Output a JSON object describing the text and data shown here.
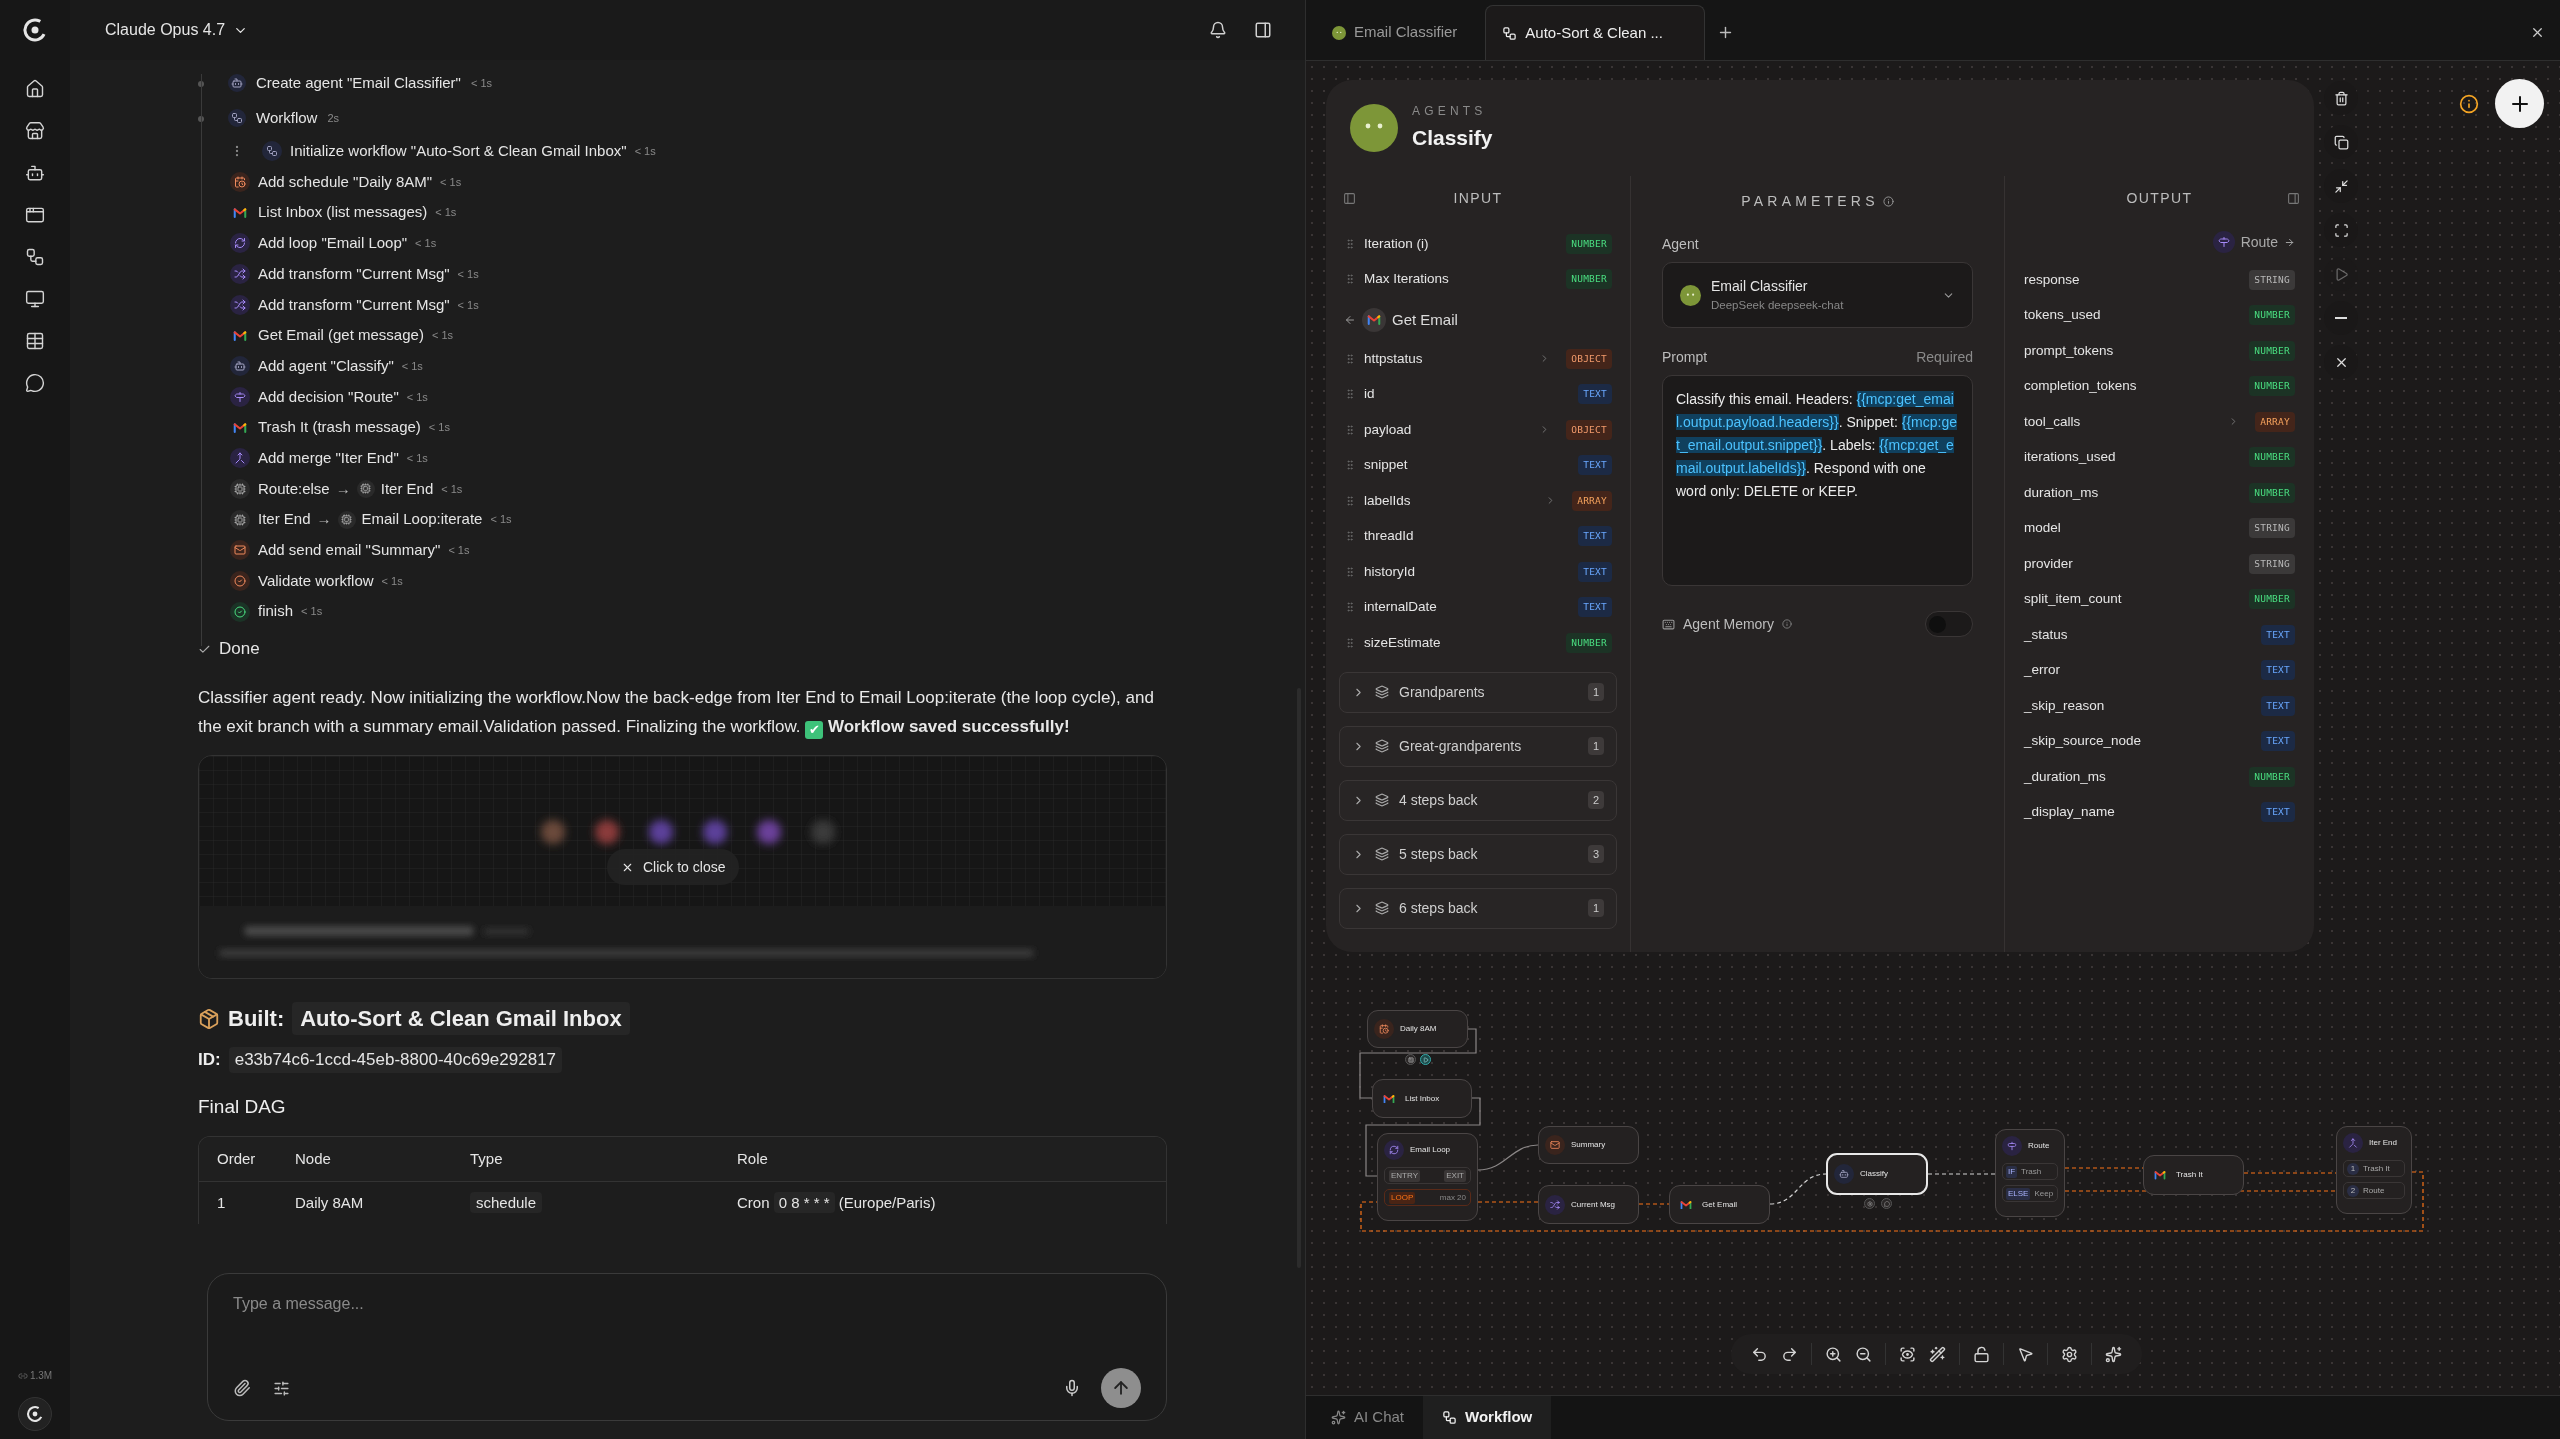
{
  "header": {
    "model": "Claude Opus 4.7"
  },
  "sidebar": {
    "usage": "1.3M"
  },
  "activity": {
    "items": [
      {
        "kind": "agent",
        "text": "Create agent \"Email Classifier\"",
        "time": "< 1s"
      },
      {
        "kind": "workflow",
        "text": "Workflow",
        "time": "2s",
        "children": [
          {
            "kind": "workflow",
            "text": "Initialize workflow \"Auto-Sort & Clean Gmail Inbox\"",
            "time": "< 1s"
          },
          {
            "kind": "schedule",
            "text": "Add schedule \"Daily 8AM\"",
            "time": "< 1s"
          },
          {
            "kind": "gmail",
            "text": "List Inbox (list messages)",
            "time": "< 1s"
          },
          {
            "kind": "loop",
            "text": "Add loop \"Email Loop\"",
            "time": "< 1s"
          },
          {
            "kind": "transform",
            "text": "Add transform \"Current Msg\"",
            "time": "< 1s"
          },
          {
            "kind": "transform",
            "text": "Add transform \"Current Msg\"",
            "time": "< 1s"
          },
          {
            "kind": "gmail",
            "text": "Get Email (get message)",
            "time": "< 1s"
          },
          {
            "kind": "agent",
            "text": "Add agent \"Classify\"",
            "time": "< 1s"
          },
          {
            "kind": "decision",
            "text": "Add decision \"Route\"",
            "time": "< 1s"
          },
          {
            "kind": "gmail",
            "text": "Trash It (trash message)",
            "time": "< 1s"
          },
          {
            "kind": "merge",
            "text": "Add merge \"Iter End\"",
            "time": "< 1s"
          },
          {
            "kind": "edge",
            "from": "Route:else",
            "arrow": "→",
            "to": "Iter End",
            "time": "< 1s"
          },
          {
            "kind": "edge",
            "from": "Iter End",
            "arrow": "→",
            "to": "Email Loop:iterate",
            "time": "< 1s"
          },
          {
            "kind": "email",
            "text": "Add send email \"Summary\"",
            "time": "< 1s"
          },
          {
            "kind": "validate",
            "text": "Validate workflow",
            "time": "< 1s"
          },
          {
            "kind": "finish",
            "text": "finish",
            "time": "< 1s"
          }
        ]
      }
    ],
    "done": "Done"
  },
  "message": {
    "text": "Classifier agent ready. Now initializing the workflow.Now the back-edge from Iter End to Email Loop:iterate (the loop cycle), and the exit branch with a summary email.Validation passed. Finalizing the workflow.",
    "status_icon": "✔",
    "status": "Workflow saved successfully!"
  },
  "preview": {
    "close_label": "Click to close"
  },
  "built": {
    "label": "Built:",
    "name": "Auto-Sort & Clean Gmail Inbox"
  },
  "workflow_id": {
    "label": "ID:",
    "value": "e33b74c6-1ccd-45eb-8800-40c69e292817"
  },
  "dag": {
    "title": "Final DAG",
    "columns": [
      "Order",
      "Node",
      "Type",
      "Role"
    ],
    "rows": [
      {
        "order": "1",
        "node": "Daily 8AM",
        "type": "schedule",
        "role": "Cron",
        "role_code": "0 8 * * *",
        "role_note": "(Europe/Paris)"
      }
    ]
  },
  "composer": {
    "placeholder": "Type a message..."
  },
  "tabs": [
    {
      "label": "Email Classifier",
      "kind": "agent",
      "selected": false
    },
    {
      "label": "Auto-Sort & Clean ...",
      "kind": "workflow",
      "selected": true
    }
  ],
  "node_panel": {
    "category": "AGENTS",
    "title": "Classify",
    "input": {
      "title": "INPUT",
      "fields": [
        {
          "name": "Iteration (i)",
          "type": "NUMBER",
          "kind": "number",
          "expandable": false
        },
        {
          "name": "Max Iterations",
          "type": "NUMBER",
          "kind": "number",
          "expandable": false
        }
      ],
      "source": {
        "label": "Get Email",
        "fields": [
          {
            "name": "httpstatus",
            "type": "OBJECT",
            "kind": "object",
            "expandable": true
          },
          {
            "name": "id",
            "type": "TEXT",
            "kind": "text",
            "expandable": false
          },
          {
            "name": "payload",
            "type": "OBJECT",
            "kind": "object",
            "expandable": true
          },
          {
            "name": "snippet",
            "type": "TEXT",
            "kind": "text",
            "expandable": false
          },
          {
            "name": "labelIds",
            "type": "ARRAY",
            "kind": "array",
            "expandable": true
          },
          {
            "name": "threadId",
            "type": "TEXT",
            "kind": "text",
            "expandable": false
          },
          {
            "name": "historyId",
            "type": "TEXT",
            "kind": "text",
            "expandable": false
          },
          {
            "name": "internalDate",
            "type": "TEXT",
            "kind": "text",
            "expandable": false
          },
          {
            "name": "sizeEstimate",
            "type": "NUMBER",
            "kind": "number",
            "expandable": false
          }
        ]
      },
      "groups": [
        {
          "label": "Grandparents",
          "count": "1"
        },
        {
          "label": "Great-grandparents",
          "count": "1"
        },
        {
          "label": "4 steps back",
          "count": "2"
        },
        {
          "label": "5 steps back",
          "count": "3"
        },
        {
          "label": "6 steps back",
          "count": "1"
        }
      ]
    },
    "parameters": {
      "title": "PARAMETERS",
      "agent_label": "Agent",
      "agent": {
        "name": "Email Classifier",
        "model": "DeepSeek deepseek-chat"
      },
      "prompt_label": "Prompt",
      "required": "Required",
      "prompt": [
        {
          "kind": "text",
          "text": "Classify this email. Headers: "
        },
        {
          "kind": "variable",
          "text": "{{mcp:get_email.output.payload.headers}}"
        },
        {
          "kind": "text",
          "text": ". Snippet: "
        },
        {
          "kind": "variable",
          "text": "{{mcp:get_email.output.snippet}}"
        },
        {
          "kind": "text",
          "text": ". Labels: "
        },
        {
          "kind": "variable",
          "text": "{{mcp:get_email.output.labelIds}}"
        },
        {
          "kind": "text",
          "text": ". Respond with one word only: DELETE or KEEP."
        }
      ],
      "memory_label": "Agent Memory",
      "memory_on": false
    },
    "output": {
      "title": "OUTPUT",
      "next": "Route",
      "fields": [
        {
          "name": "response",
          "type": "STRING",
          "kind": "string",
          "expandable": false
        },
        {
          "name": "tokens_used",
          "type": "NUMBER",
          "kind": "number",
          "expandable": false
        },
        {
          "name": "prompt_tokens",
          "type": "NUMBER",
          "kind": "number",
          "expandable": false
        },
        {
          "name": "completion_tokens",
          "type": "NUMBER",
          "kind": "number",
          "expandable": false
        },
        {
          "name": "tool_calls",
          "type": "ARRAY",
          "kind": "array",
          "expandable": true
        },
        {
          "name": "iterations_used",
          "type": "NUMBER",
          "kind": "number",
          "expandable": false
        },
        {
          "name": "duration_ms",
          "type": "NUMBER",
          "kind": "number",
          "expandable": false
        },
        {
          "name": "model",
          "type": "STRING",
          "kind": "string",
          "expandable": false
        },
        {
          "name": "provider",
          "type": "STRING",
          "kind": "string",
          "expandable": false
        },
        {
          "name": "split_item_count",
          "type": "NUMBER",
          "kind": "number",
          "expandable": false
        },
        {
          "name": "_status",
          "type": "TEXT",
          "kind": "text",
          "expandable": false
        },
        {
          "name": "_error",
          "type": "TEXT",
          "kind": "text",
          "expandable": false
        },
        {
          "name": "_skip_reason",
          "type": "TEXT",
          "kind": "text",
          "expandable": false
        },
        {
          "name": "_skip_source_node",
          "type": "TEXT",
          "kind": "text",
          "expandable": false
        },
        {
          "name": "_duration_ms",
          "type": "NUMBER",
          "kind": "number",
          "expandable": false
        },
        {
          "name": "_display_name",
          "type": "TEXT",
          "kind": "text",
          "expandable": false
        }
      ]
    }
  },
  "graph": {
    "nodes": [
      {
        "label": "Daily 8AM",
        "kind": "schedule",
        "selected": false
      },
      {
        "label": "List Inbox",
        "kind": "gmail",
        "selected": false
      },
      {
        "label": "Email Loop",
        "kind": "loop",
        "selected": false,
        "ports": [
          "ENTRY",
          "EXIT"
        ],
        "loop": {
          "label": "LOOP",
          "limit": "max 20"
        }
      },
      {
        "label": "Summary",
        "kind": "email",
        "selected": false
      },
      {
        "label": "Current Msg",
        "kind": "transform",
        "selected": false
      },
      {
        "label": "Get Email",
        "kind": "gmail",
        "selected": false
      },
      {
        "label": "Classify",
        "kind": "agent",
        "selected": true
      },
      {
        "label": "Route",
        "kind": "decision",
        "selected": false,
        "branches": [
          {
            "tag": "IF",
            "label": "Trash"
          },
          {
            "tag": "ELSE",
            "label": "Keep"
          }
        ]
      },
      {
        "label": "Trash It",
        "kind": "gmail",
        "selected": false
      },
      {
        "label": "Iter End",
        "kind": "merge",
        "selected": false,
        "inputs": [
          {
            "index": "1",
            "label": "Trash It"
          },
          {
            "index": "2",
            "label": "Route"
          }
        ]
      }
    ]
  },
  "bottom_tabs": [
    {
      "label": "AI Chat",
      "kind": "chat",
      "selected": false
    },
    {
      "label": "Workflow",
      "kind": "workflow",
      "selected": true
    }
  ]
}
